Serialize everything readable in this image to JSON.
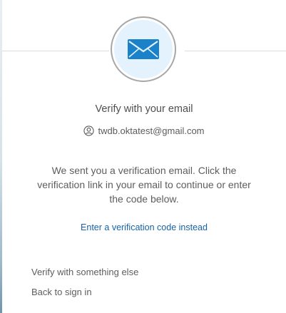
{
  "header": {
    "icon": "email-envelope-icon",
    "accent_color": "#1b81c9",
    "badge_fill_color": "#e3f2fc"
  },
  "main": {
    "title": "Verify with your email",
    "identifier": {
      "icon": "user-circle-icon",
      "text": "twdb.oktatest@gmail.com"
    },
    "message": "We sent you a verification email. Click the verification link in your email to continue or enter the code below.",
    "enter_code_link": "Enter a verification code instead"
  },
  "footer": {
    "verify_other_link": "Verify with something else",
    "back_link": "Back to sign in"
  }
}
